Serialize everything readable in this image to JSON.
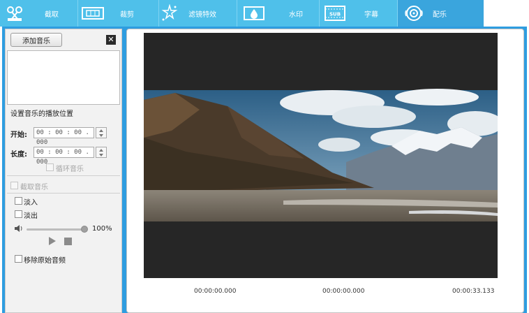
{
  "toolbar": {
    "items": [
      {
        "label": "截取",
        "icon": "film-cut-icon"
      },
      {
        "label": "裁剪",
        "icon": "crop-icon"
      },
      {
        "label": "滤镜特效",
        "icon": "effects-sparkle-icon"
      },
      {
        "label": "水印",
        "icon": "watermark-drop-icon"
      },
      {
        "label": "字幕",
        "icon": "subtitle-icon"
      },
      {
        "label": "配乐",
        "icon": "music-disc-icon"
      }
    ],
    "subtitle_icon_text": "SUB",
    "active_tab": "配乐",
    "accent_color": "#4fc0ea",
    "active_color": "#3aa5dd"
  },
  "music_panel": {
    "add_button": "添加音乐",
    "close_glyph": "✕",
    "position_title": "设置音乐的播放位置",
    "start_label": "开始:",
    "start_value": "00 : 00 : 00 . 000",
    "length_label": "长度:",
    "length_value": "00 : 00 : 00 . 000",
    "loop_label": "循环音乐",
    "trim_label": "截取音乐",
    "fade_in_label": "淡入",
    "fade_out_label": "淡出",
    "volume_percent": "100%",
    "volume_level": 1.0,
    "remove_original_label": "移除原始音频"
  },
  "preview": {
    "time_left": "00:00:00.000",
    "time_center": "00:00:00.000",
    "time_right": "00:00:33.133"
  }
}
